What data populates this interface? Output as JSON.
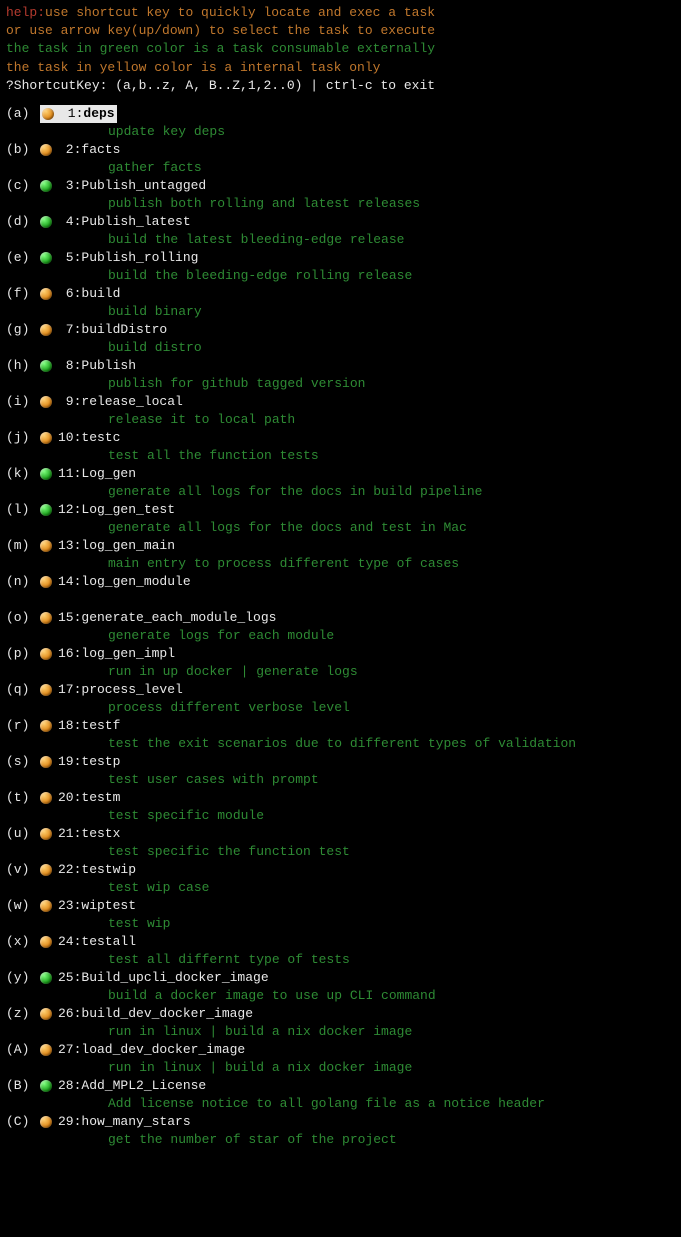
{
  "help": {
    "label": "help:",
    "line1": "use shortcut key to quickly locate and exec a task",
    "line2": "or use arrow key(up/down) to select the task to execute",
    "line3": "the task in green color is a task consumable externally",
    "line4": "the task in yellow color is a internal task only",
    "prompt": "?ShortcutKey: (a,b..z, A, B..Z,1,2..0) | ctrl-c to exit"
  },
  "tasks": [
    {
      "key": "(a)",
      "dot": "orange",
      "idx": " 1",
      "name": "deps",
      "desc": "update key deps",
      "selected": true
    },
    {
      "key": "(b)",
      "dot": "orange",
      "idx": " 2",
      "name": "facts",
      "desc": "gather facts"
    },
    {
      "key": "(c)",
      "dot": "green",
      "idx": " 3",
      "name": "Publish_untagged",
      "desc": "publish both rolling and latest releases"
    },
    {
      "key": "(d)",
      "dot": "green",
      "idx": " 4",
      "name": "Publish_latest",
      "desc": "build the latest bleeding-edge release"
    },
    {
      "key": "(e)",
      "dot": "green",
      "idx": " 5",
      "name": "Publish_rolling",
      "desc": "build the bleeding-edge rolling release"
    },
    {
      "key": "(f)",
      "dot": "orange",
      "idx": " 6",
      "name": "build",
      "desc": "build binary"
    },
    {
      "key": "(g)",
      "dot": "orange",
      "idx": " 7",
      "name": "buildDistro",
      "desc": "build distro"
    },
    {
      "key": "(h)",
      "dot": "green",
      "idx": " 8",
      "name": "Publish",
      "desc": "publish for github tagged version"
    },
    {
      "key": "(i)",
      "dot": "orange",
      "idx": " 9",
      "name": "release_local",
      "desc": "release it to local path"
    },
    {
      "key": "(j)",
      "dot": "orange",
      "idx": "10",
      "name": "testc",
      "desc": "test all the function tests"
    },
    {
      "key": "(k)",
      "dot": "green",
      "idx": "11",
      "name": "Log_gen",
      "desc": "generate all logs for the docs in build pipeline"
    },
    {
      "key": "(l)",
      "dot": "green",
      "idx": "12",
      "name": "Log_gen_test",
      "desc": "generate all logs for the docs and test in Mac"
    },
    {
      "key": "(m)",
      "dot": "orange",
      "idx": "13",
      "name": "log_gen_main",
      "desc": "main entry to process different type of cases"
    },
    {
      "key": "(n)",
      "dot": "orange",
      "idx": "14",
      "name": "log_gen_module",
      "desc": ""
    },
    {
      "key": "(o)",
      "dot": "orange",
      "idx": "15",
      "name": "generate_each_module_logs",
      "desc": "generate logs for each module"
    },
    {
      "key": "(p)",
      "dot": "orange",
      "idx": "16",
      "name": "log_gen_impl",
      "desc": "run in up docker | generate logs"
    },
    {
      "key": "(q)",
      "dot": "orange",
      "idx": "17",
      "name": "process_level",
      "desc": "process different verbose level"
    },
    {
      "key": "(r)",
      "dot": "orange",
      "idx": "18",
      "name": "testf",
      "desc": "test the exit scenarios due to different types of validation"
    },
    {
      "key": "(s)",
      "dot": "orange",
      "idx": "19",
      "name": "testp",
      "desc": "test user cases with prompt"
    },
    {
      "key": "(t)",
      "dot": "orange",
      "idx": "20",
      "name": "testm",
      "desc": "test specific module"
    },
    {
      "key": "(u)",
      "dot": "orange",
      "idx": "21",
      "name": "testx",
      "desc": "test specific the function test"
    },
    {
      "key": "(v)",
      "dot": "orange",
      "idx": "22",
      "name": "testwip",
      "desc": "test wip case"
    },
    {
      "key": "(w)",
      "dot": "orange",
      "idx": "23",
      "name": "wiptest",
      "desc": "test wip"
    },
    {
      "key": "(x)",
      "dot": "orange",
      "idx": "24",
      "name": "testall",
      "desc": "test all differnt type of tests"
    },
    {
      "key": "(y)",
      "dot": "green",
      "idx": "25",
      "name": "Build_upcli_docker_image",
      "desc": "build a docker image to use up CLI command"
    },
    {
      "key": "(z)",
      "dot": "orange",
      "idx": "26",
      "name": "build_dev_docker_image",
      "desc": "run in linux | build a nix docker image"
    },
    {
      "key": "(A)",
      "dot": "orange",
      "idx": "27",
      "name": "load_dev_docker_image",
      "desc": "run in linux | build a nix docker image"
    },
    {
      "key": "(B)",
      "dot": "green",
      "idx": "28",
      "name": "Add_MPL2_License",
      "desc": "Add license notice to all golang file as a notice header"
    },
    {
      "key": "(C)",
      "dot": "orange",
      "idx": "29",
      "name": "how_many_stars",
      "desc": "get the number of star of the project"
    }
  ]
}
